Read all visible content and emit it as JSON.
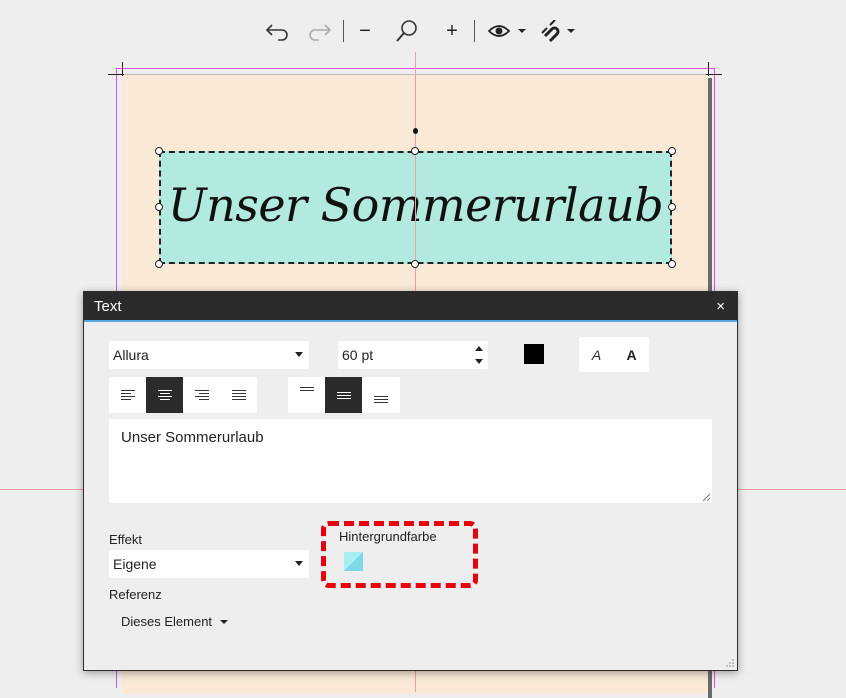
{
  "toolbar": {
    "undo_icon": "undo-arrow-icon",
    "redo_icon": "redo-arrow-icon",
    "zoom_out": "−",
    "zoom_in": "+",
    "zoom_icon": "magnifier-icon",
    "view_icon": "eye-icon",
    "snap_icon": "magnet-icon"
  },
  "canvas": {
    "textbox_text": "Unser Sommerurlaub",
    "textbox_bg": "#b3eae0",
    "page_bg": "#f9e9d6"
  },
  "dialog": {
    "title": "Text",
    "close": "×",
    "font": "Allura",
    "size": "60 pt",
    "text_color": "#000000",
    "style_italic": "A",
    "style_bold": "A",
    "text_value": "Unser Sommerurlaub",
    "effect_label": "Effekt",
    "effect_value": "Eigene",
    "background_label": "Hintergrundfarbe",
    "background_color": "#a6eef3",
    "reference_label": "Referenz",
    "reference_value": "Dieses Element"
  }
}
